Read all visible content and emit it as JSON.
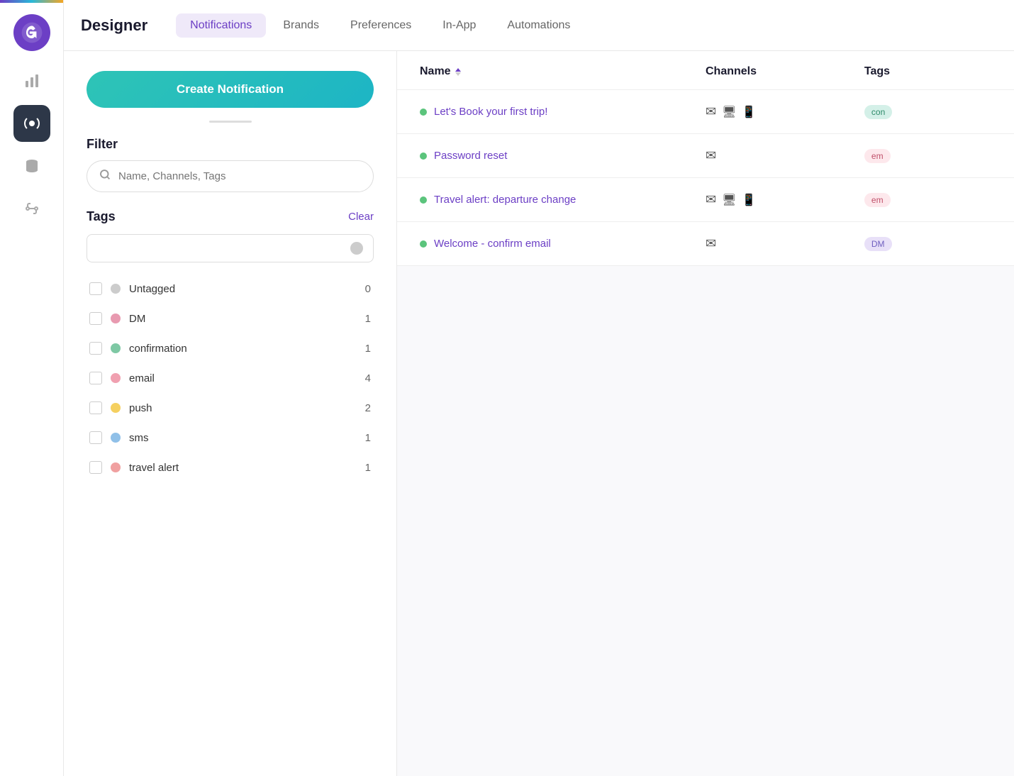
{
  "app": {
    "title": "Designer"
  },
  "topnav": {
    "tabs": [
      {
        "id": "notifications",
        "label": "Notifications",
        "active": true
      },
      {
        "id": "brands",
        "label": "Brands",
        "active": false
      },
      {
        "id": "preferences",
        "label": "Preferences",
        "active": false
      },
      {
        "id": "in-app",
        "label": "In-App",
        "active": false
      },
      {
        "id": "automations",
        "label": "Automations",
        "active": false
      }
    ]
  },
  "left_panel": {
    "create_button_label": "Create Notification",
    "filter_label": "Filter",
    "search_placeholder": "Name, Channels, Tags",
    "tags_label": "Tags",
    "clear_label": "Clear",
    "tag_search_placeholder": "",
    "tags": [
      {
        "id": "untagged",
        "name": "Untagged",
        "dot": "gray",
        "count": 0,
        "radio": true
      },
      {
        "id": "dm",
        "name": "DM",
        "dot": "pink",
        "count": 1
      },
      {
        "id": "confirmation",
        "name": "confirmation",
        "dot": "green",
        "count": 1
      },
      {
        "id": "email",
        "name": "email",
        "dot": "light-pink",
        "count": 4
      },
      {
        "id": "push",
        "name": "push",
        "dot": "yellow",
        "count": 2
      },
      {
        "id": "sms",
        "name": "sms",
        "dot": "blue",
        "count": 1
      },
      {
        "id": "travel-alert",
        "name": "travel alert",
        "dot": "salmon",
        "count": 1
      }
    ]
  },
  "notifications_table": {
    "columns": {
      "name": "Name",
      "channels": "Channels",
      "tags": "Tags"
    },
    "rows": [
      {
        "id": "1",
        "name": "Let's Book your first trip!",
        "channels": [
          "email",
          "desktop",
          "mobile"
        ],
        "tags": [
          {
            "label": "con",
            "type": "confirmation"
          }
        ]
      },
      {
        "id": "2",
        "name": "Password reset",
        "channels": [
          "email"
        ],
        "tags": [
          {
            "label": "em",
            "type": "email"
          }
        ]
      },
      {
        "id": "3",
        "name": "Travel alert: departure change",
        "channels": [
          "email",
          "desktop",
          "mobile"
        ],
        "tags": [
          {
            "label": "em",
            "type": "email"
          }
        ]
      },
      {
        "id": "4",
        "name": "Welcome - confirm email",
        "channels": [
          "email"
        ],
        "tags": [
          {
            "label": "DM",
            "type": "dm"
          }
        ]
      }
    ]
  },
  "icons": {
    "email": "✉",
    "desktop": "🖥",
    "mobile": "📱"
  }
}
